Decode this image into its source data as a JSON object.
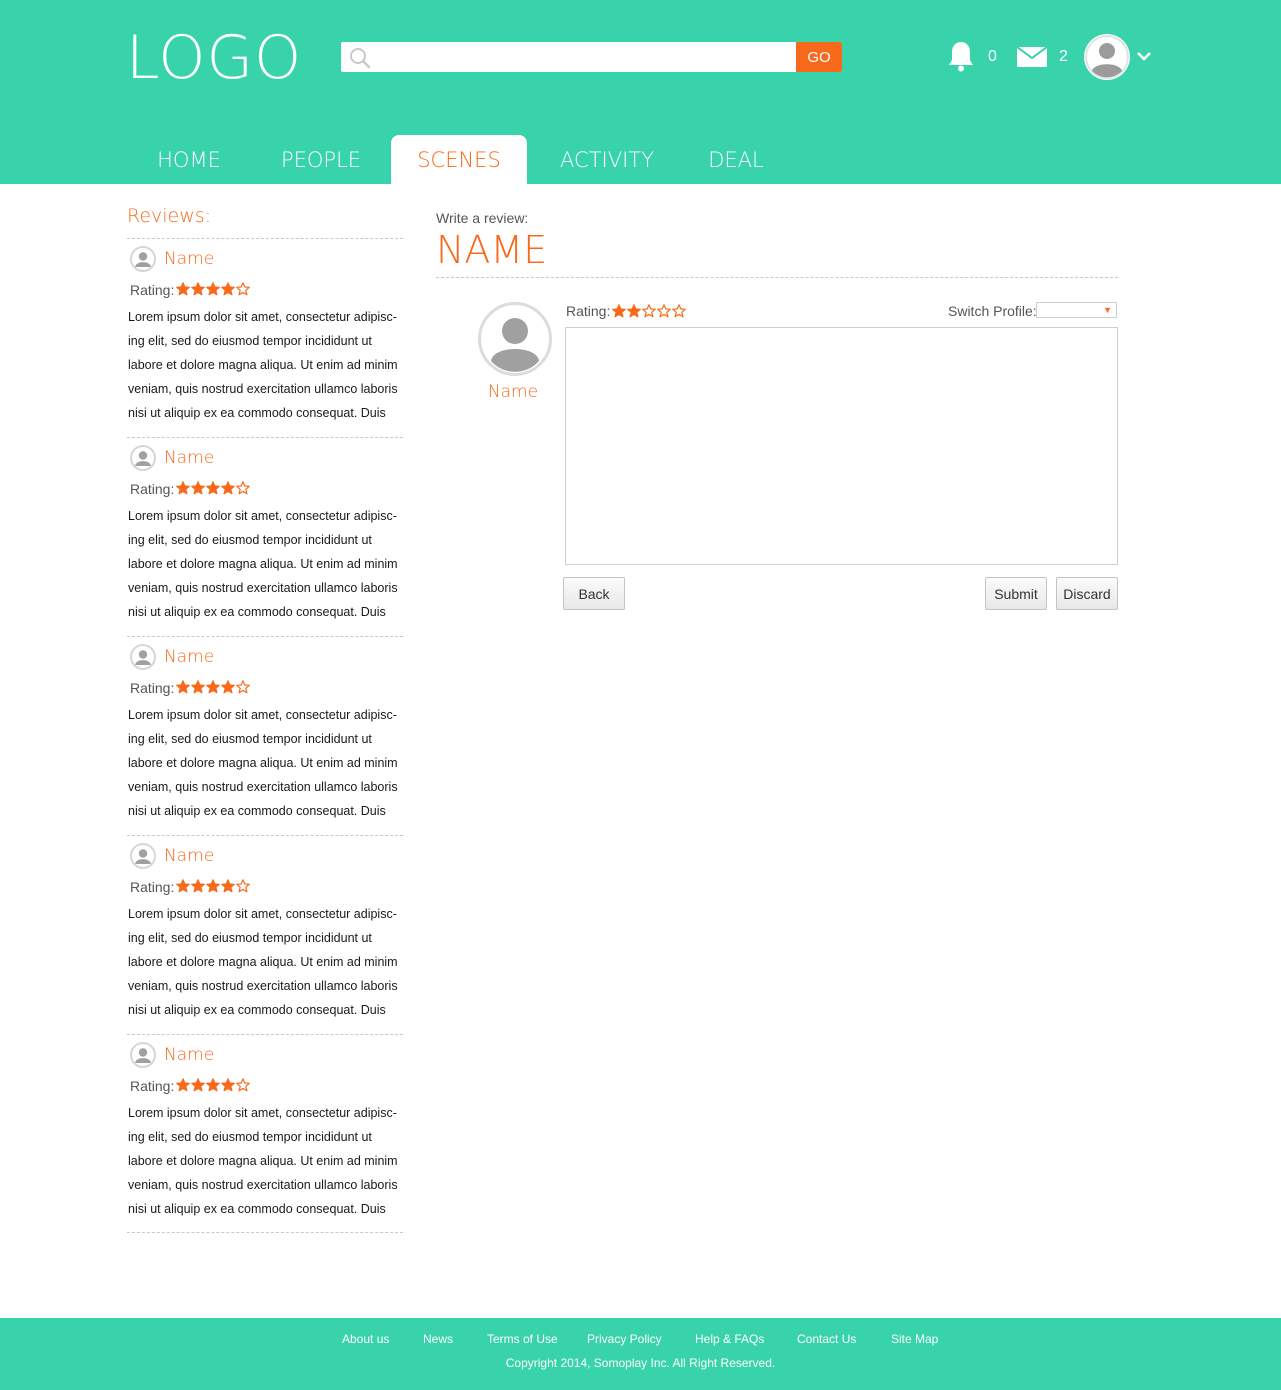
{
  "header": {
    "logo": "LOGO",
    "search": {
      "placeholder": "",
      "value": "",
      "go_label": "GO"
    },
    "notifications_count": "0",
    "messages_count": "2"
  },
  "nav": {
    "tabs": [
      {
        "label": "HOME",
        "active": false
      },
      {
        "label": "PEOPLE",
        "active": false
      },
      {
        "label": "SCENES",
        "active": true
      },
      {
        "label": "ACTIVITY",
        "active": false
      },
      {
        "label": "DEAL",
        "active": false
      }
    ]
  },
  "reviews": {
    "title": "Reviews:",
    "rating_label": "Rating:",
    "items": [
      {
        "name": "Name",
        "stars": 4,
        "text": "Lorem ipsum dolor sit amet, consectetur adipisc-ing elit, sed do eiusmod tempor incididunt ut labore et dolore magna aliqua. Ut enim ad minim veniam, quis nostrud exercitation ullamco laboris nisi ut aliquip ex ea commodo consequat. Duis"
      },
      {
        "name": "Name",
        "stars": 4,
        "text": "Lorem ipsum dolor sit amet, consectetur adipisc-ing elit, sed do eiusmod tempor incididunt ut labore et dolore magna aliqua. Ut enim ad minim veniam, quis nostrud exercitation ullamco laboris nisi ut aliquip ex ea commodo consequat. Duis"
      },
      {
        "name": "Name",
        "stars": 4,
        "text": "Lorem ipsum dolor sit amet, consectetur adipisc-ing elit, sed do eiusmod tempor incididunt ut labore et dolore magna aliqua. Ut enim ad minim veniam, quis nostrud exercitation ullamco laboris nisi ut aliquip ex ea commodo consequat. Duis"
      },
      {
        "name": "Name",
        "stars": 4,
        "text": "Lorem ipsum dolor sit amet, consectetur adipisc-ing elit, sed do eiusmod tempor incididunt ut labore et dolore magna aliqua. Ut enim ad minim veniam, quis nostrud exercitation ullamco laboris nisi ut aliquip ex ea commodo consequat. Duis"
      },
      {
        "name": "Name",
        "stars": 4,
        "text": "Lorem ipsum dolor sit amet, consectetur adipisc-ing elit, sed do eiusmod tempor incididunt ut labore et dolore magna aliqua. Ut enim ad minim veniam, quis nostrud exercitation ullamco laboris nisi ut aliquip ex ea commodo consequat. Duis"
      }
    ]
  },
  "write_review": {
    "label": "Write a review:",
    "title": "NAME",
    "profile_name": "Name",
    "rating_label": "Rating:",
    "rating_stars": 2,
    "switch_profile_label": "Switch Profile:",
    "switch_profile_value": "",
    "textarea_value": "",
    "back_label": "Back",
    "submit_label": "Submit",
    "discard_label": "Discard"
  },
  "footer": {
    "links": [
      "About us",
      "News",
      "Terms of Use",
      "Privacy Policy",
      "Help & FAQs",
      "Contact Us",
      "Site Map"
    ],
    "copyright": "Copyright 2014, Somoplay Inc. All Right Reserved."
  },
  "colors": {
    "brand": "#38d3aa",
    "accent": "#f76a1b"
  },
  "icons": [
    "search-icon",
    "bell-icon",
    "mail-icon",
    "avatar",
    "chevron-down-icon",
    "star-icon"
  ]
}
